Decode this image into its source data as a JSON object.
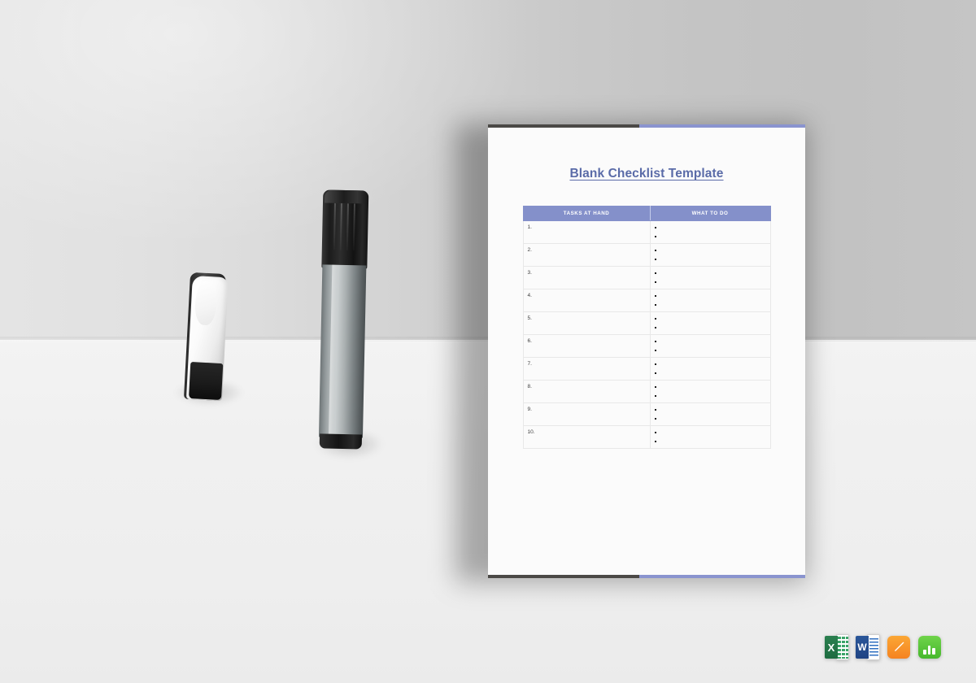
{
  "document": {
    "title": "Blank Checklist Template",
    "table": {
      "headers": [
        "TASKS AT HAND",
        "WHAT TO DO"
      ],
      "rows": [
        {
          "number": "1.",
          "task": "",
          "todo": [
            "",
            ""
          ]
        },
        {
          "number": "2.",
          "task": "",
          "todo": [
            "",
            ""
          ]
        },
        {
          "number": "3.",
          "task": "",
          "todo": [
            "",
            ""
          ]
        },
        {
          "number": "4.",
          "task": "",
          "todo": [
            "",
            ""
          ]
        },
        {
          "number": "5.",
          "task": "",
          "todo": [
            "",
            ""
          ]
        },
        {
          "number": "6.",
          "task": "",
          "todo": [
            "",
            ""
          ]
        },
        {
          "number": "7.",
          "task": "",
          "todo": [
            "",
            ""
          ]
        },
        {
          "number": "8.",
          "task": "",
          "todo": [
            "",
            ""
          ]
        },
        {
          "number": "9.",
          "task": "",
          "todo": [
            "",
            ""
          ]
        },
        {
          "number": "10.",
          "task": "",
          "todo": [
            "",
            ""
          ]
        }
      ]
    },
    "colors": {
      "title_color": "#5a6ba8",
      "header_bar": "#8490ca",
      "edge_dark": "#4b4946",
      "edge_blue": "#8a94cf",
      "page_background": "#fbfbfb"
    }
  },
  "scene": {
    "objects": [
      {
        "name": "whiteboard-eraser"
      },
      {
        "name": "whiteboard-marker"
      }
    ],
    "colors": {
      "wall_left": "#e4e4e4",
      "wall_right": "#c2c2c2",
      "desk": "#f0f0f0"
    }
  },
  "format_icons": [
    {
      "name": "excel-icon",
      "label": "X",
      "accent": "#1d6b40"
    },
    {
      "name": "word-icon",
      "label": "W",
      "accent": "#2a5699"
    },
    {
      "name": "pages-icon",
      "label": "",
      "accent": "#f58220"
    },
    {
      "name": "numbers-icon",
      "label": "",
      "accent": "#46b82c"
    }
  ]
}
